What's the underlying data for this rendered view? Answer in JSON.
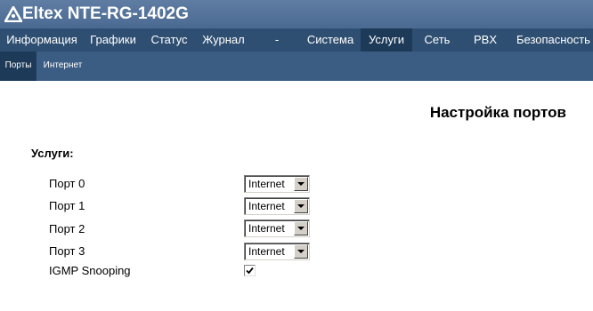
{
  "app": {
    "title": "Eltex NTE-RG-1402G",
    "logo_icon": "eltex-logo-icon"
  },
  "nav": {
    "items": [
      {
        "label": "Информация",
        "active": false
      },
      {
        "label": "Графики",
        "active": false
      },
      {
        "label": "Статус",
        "active": false
      },
      {
        "label": "Журнал",
        "active": false
      },
      {
        "label": "-",
        "active": false
      },
      {
        "label": "Система",
        "active": false
      },
      {
        "label": "Услуги",
        "active": true
      },
      {
        "label": "Сеть",
        "active": false
      },
      {
        "label": "PBX",
        "active": false
      },
      {
        "label": "Безопасность",
        "active": false
      }
    ]
  },
  "subnav": {
    "items": [
      {
        "label": "Порты",
        "active": true
      },
      {
        "label": "Интернет",
        "active": false
      }
    ]
  },
  "page": {
    "title": "Настройка портов",
    "section_title": "Услуги:"
  },
  "ports": [
    {
      "label": "Порт 0",
      "value": "Internet"
    },
    {
      "label": "Порт 1",
      "value": "Internet"
    },
    {
      "label": "Порт 2",
      "value": "Internet"
    },
    {
      "label": "Порт 3",
      "value": "Internet"
    }
  ],
  "igmp": {
    "label": "IGMP Snooping",
    "checked": true
  },
  "colors": {
    "title_bar": "#4f6e96",
    "nav_bar": "#2f4f72",
    "nav_active": "#1d3a58",
    "subnav_bar": "#3b5d84"
  }
}
